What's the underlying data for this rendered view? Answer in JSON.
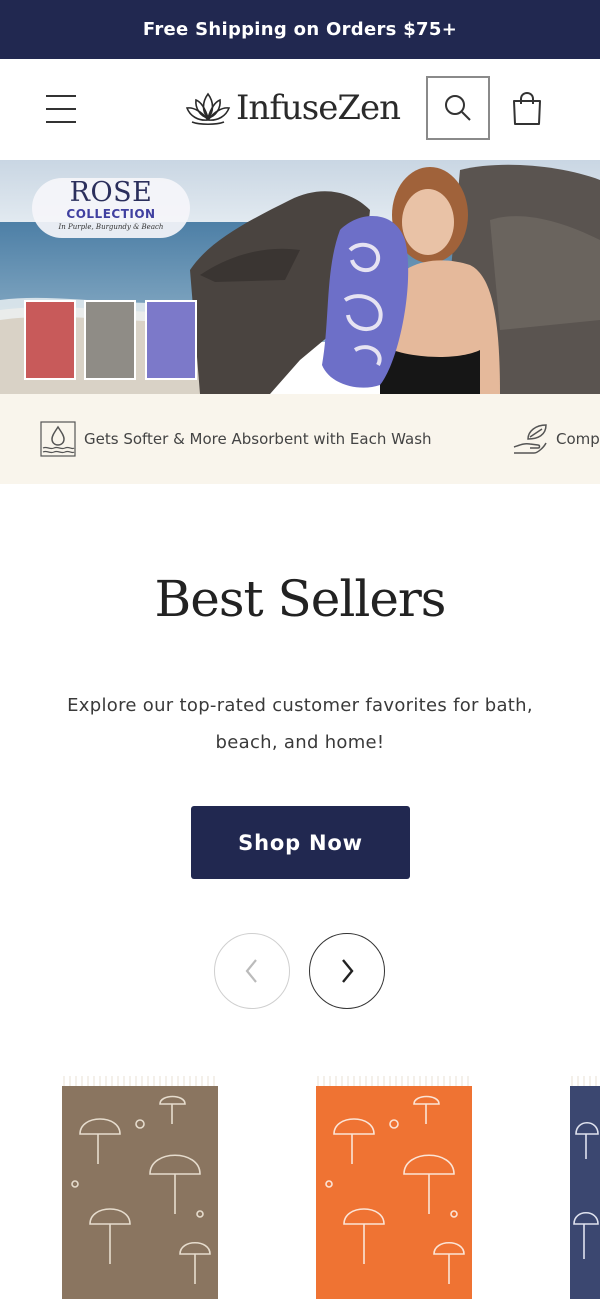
{
  "announcement": {
    "text": "Free Shipping on Orders $75+"
  },
  "header": {
    "brand": "InfuseZen",
    "menu_icon": "hamburger-menu-icon",
    "search_icon": "search-icon",
    "cart_icon": "shopping-bag-icon"
  },
  "hero": {
    "badge_title": "ROSE",
    "badge_subtitle": "COLLECTION",
    "badge_tagline": "In Purple, Burgundy & Beach",
    "swatch_colors": [
      "#c85a5a",
      "#8f8c86",
      "#7c79c9"
    ]
  },
  "features": [
    {
      "icon": "water-drop-waves-icon",
      "text": "Gets Softer & More Absorbent with Each Wash"
    },
    {
      "icon": "hand-leaf-icon",
      "text": "Comp"
    }
  ],
  "best_sellers": {
    "title": "Best Sellers",
    "description": "Explore our top-rated customer favorites for bath, beach, and home!",
    "cta": "Shop Now"
  },
  "carousel": {
    "prev_icon": "chevron-left-icon",
    "next_icon": "chevron-right-icon"
  },
  "products": [
    {
      "color": "#8a7560"
    },
    {
      "color": "#ef7333"
    },
    {
      "color": "#3b4770"
    }
  ],
  "colors": {
    "navy": "#212850",
    "cream": "#f9f5ec"
  }
}
